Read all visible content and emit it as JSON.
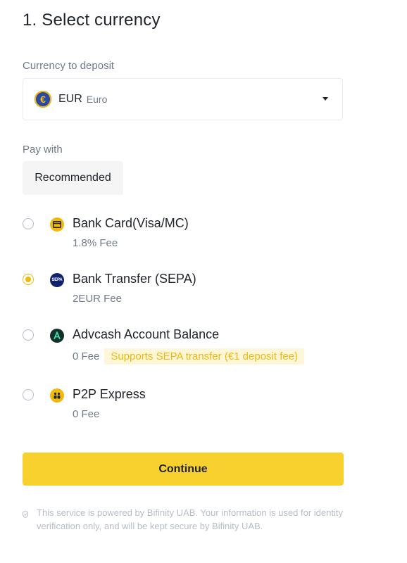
{
  "header": {
    "title": "1. Select currency"
  },
  "currency": {
    "label": "Currency to deposit",
    "code": "EUR",
    "name": "Euro",
    "symbol": "€",
    "icon": "euro-coin-icon"
  },
  "pay": {
    "label": "Pay with",
    "tab": "Recommended",
    "options": [
      {
        "title": "Bank Card(Visa/MC)",
        "fee": "1.8% Fee",
        "icon": "bank-card-icon",
        "selected": false
      },
      {
        "title": "Bank Transfer (SEPA)",
        "fee": "2EUR Fee",
        "icon": "sepa-icon",
        "icon_text": "SEPA",
        "selected": true
      },
      {
        "title": "Advcash Account Balance",
        "fee": "0 Fee",
        "badge": "Supports SEPA transfer (€1 deposit fee)",
        "icon": "advcash-icon",
        "selected": false
      },
      {
        "title": "P2P Express",
        "fee": "0 Fee",
        "icon": "p2p-icon",
        "selected": false
      }
    ]
  },
  "actions": {
    "continue": "Continue"
  },
  "footer": {
    "disclaimer": "This service is powered by Bifinity UAB. Your information is used for identity verification only, and will be kept secure by Bifinity UAB."
  },
  "colors": {
    "accent": "#F0B90B",
    "button": "#F8D12F",
    "text": "#1E2329",
    "muted": "#707A8A"
  }
}
